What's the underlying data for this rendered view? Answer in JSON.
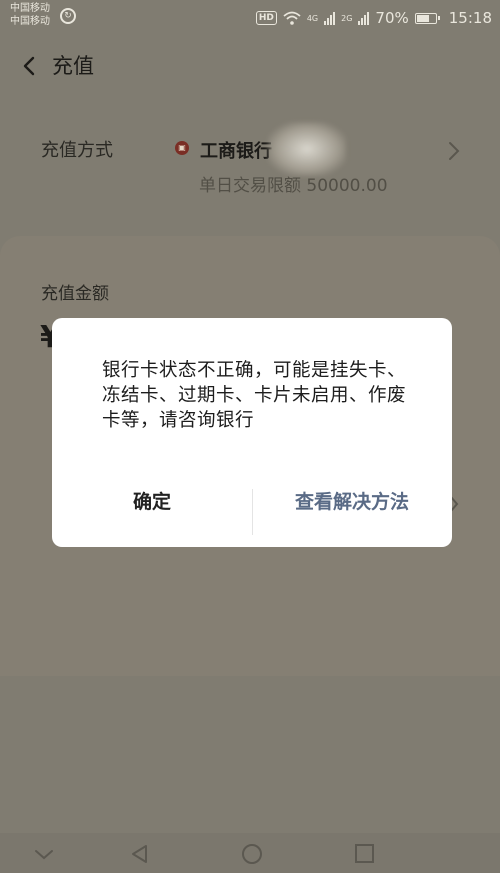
{
  "status_bar": {
    "carrier_1": "中国移动",
    "carrier_2": "中国移动",
    "hd": "HD",
    "net_4g": "4G",
    "net_2g": "2G",
    "battery": "70%",
    "battery_level": 0.7,
    "time": "15:18"
  },
  "header": {
    "title": "充值",
    "back_icon": "chevron-left-icon"
  },
  "method": {
    "label": "充值方式",
    "bank_name": "工商银行",
    "limit_text": "单日交易限额   50000.00",
    "chevron": "chevron-right-icon"
  },
  "amount": {
    "label": "充值金额",
    "currency_symbol": "¥"
  },
  "dialog": {
    "message": "银行卡状态不正确，可能是挂失卡、冻结卡、过期卡、卡片未启用、作废卡等，请咨询银行",
    "confirm_label": "确定",
    "solution_label": "查看解决方法"
  },
  "nav": {
    "icons": [
      "chevron-down-icon",
      "back-triangle-icon",
      "home-circle-icon",
      "recents-square-icon"
    ]
  },
  "colors": {
    "overlay_bg": "#807c71",
    "dialog_bg": "#ffffff",
    "solution_text": "#5a6b86"
  }
}
